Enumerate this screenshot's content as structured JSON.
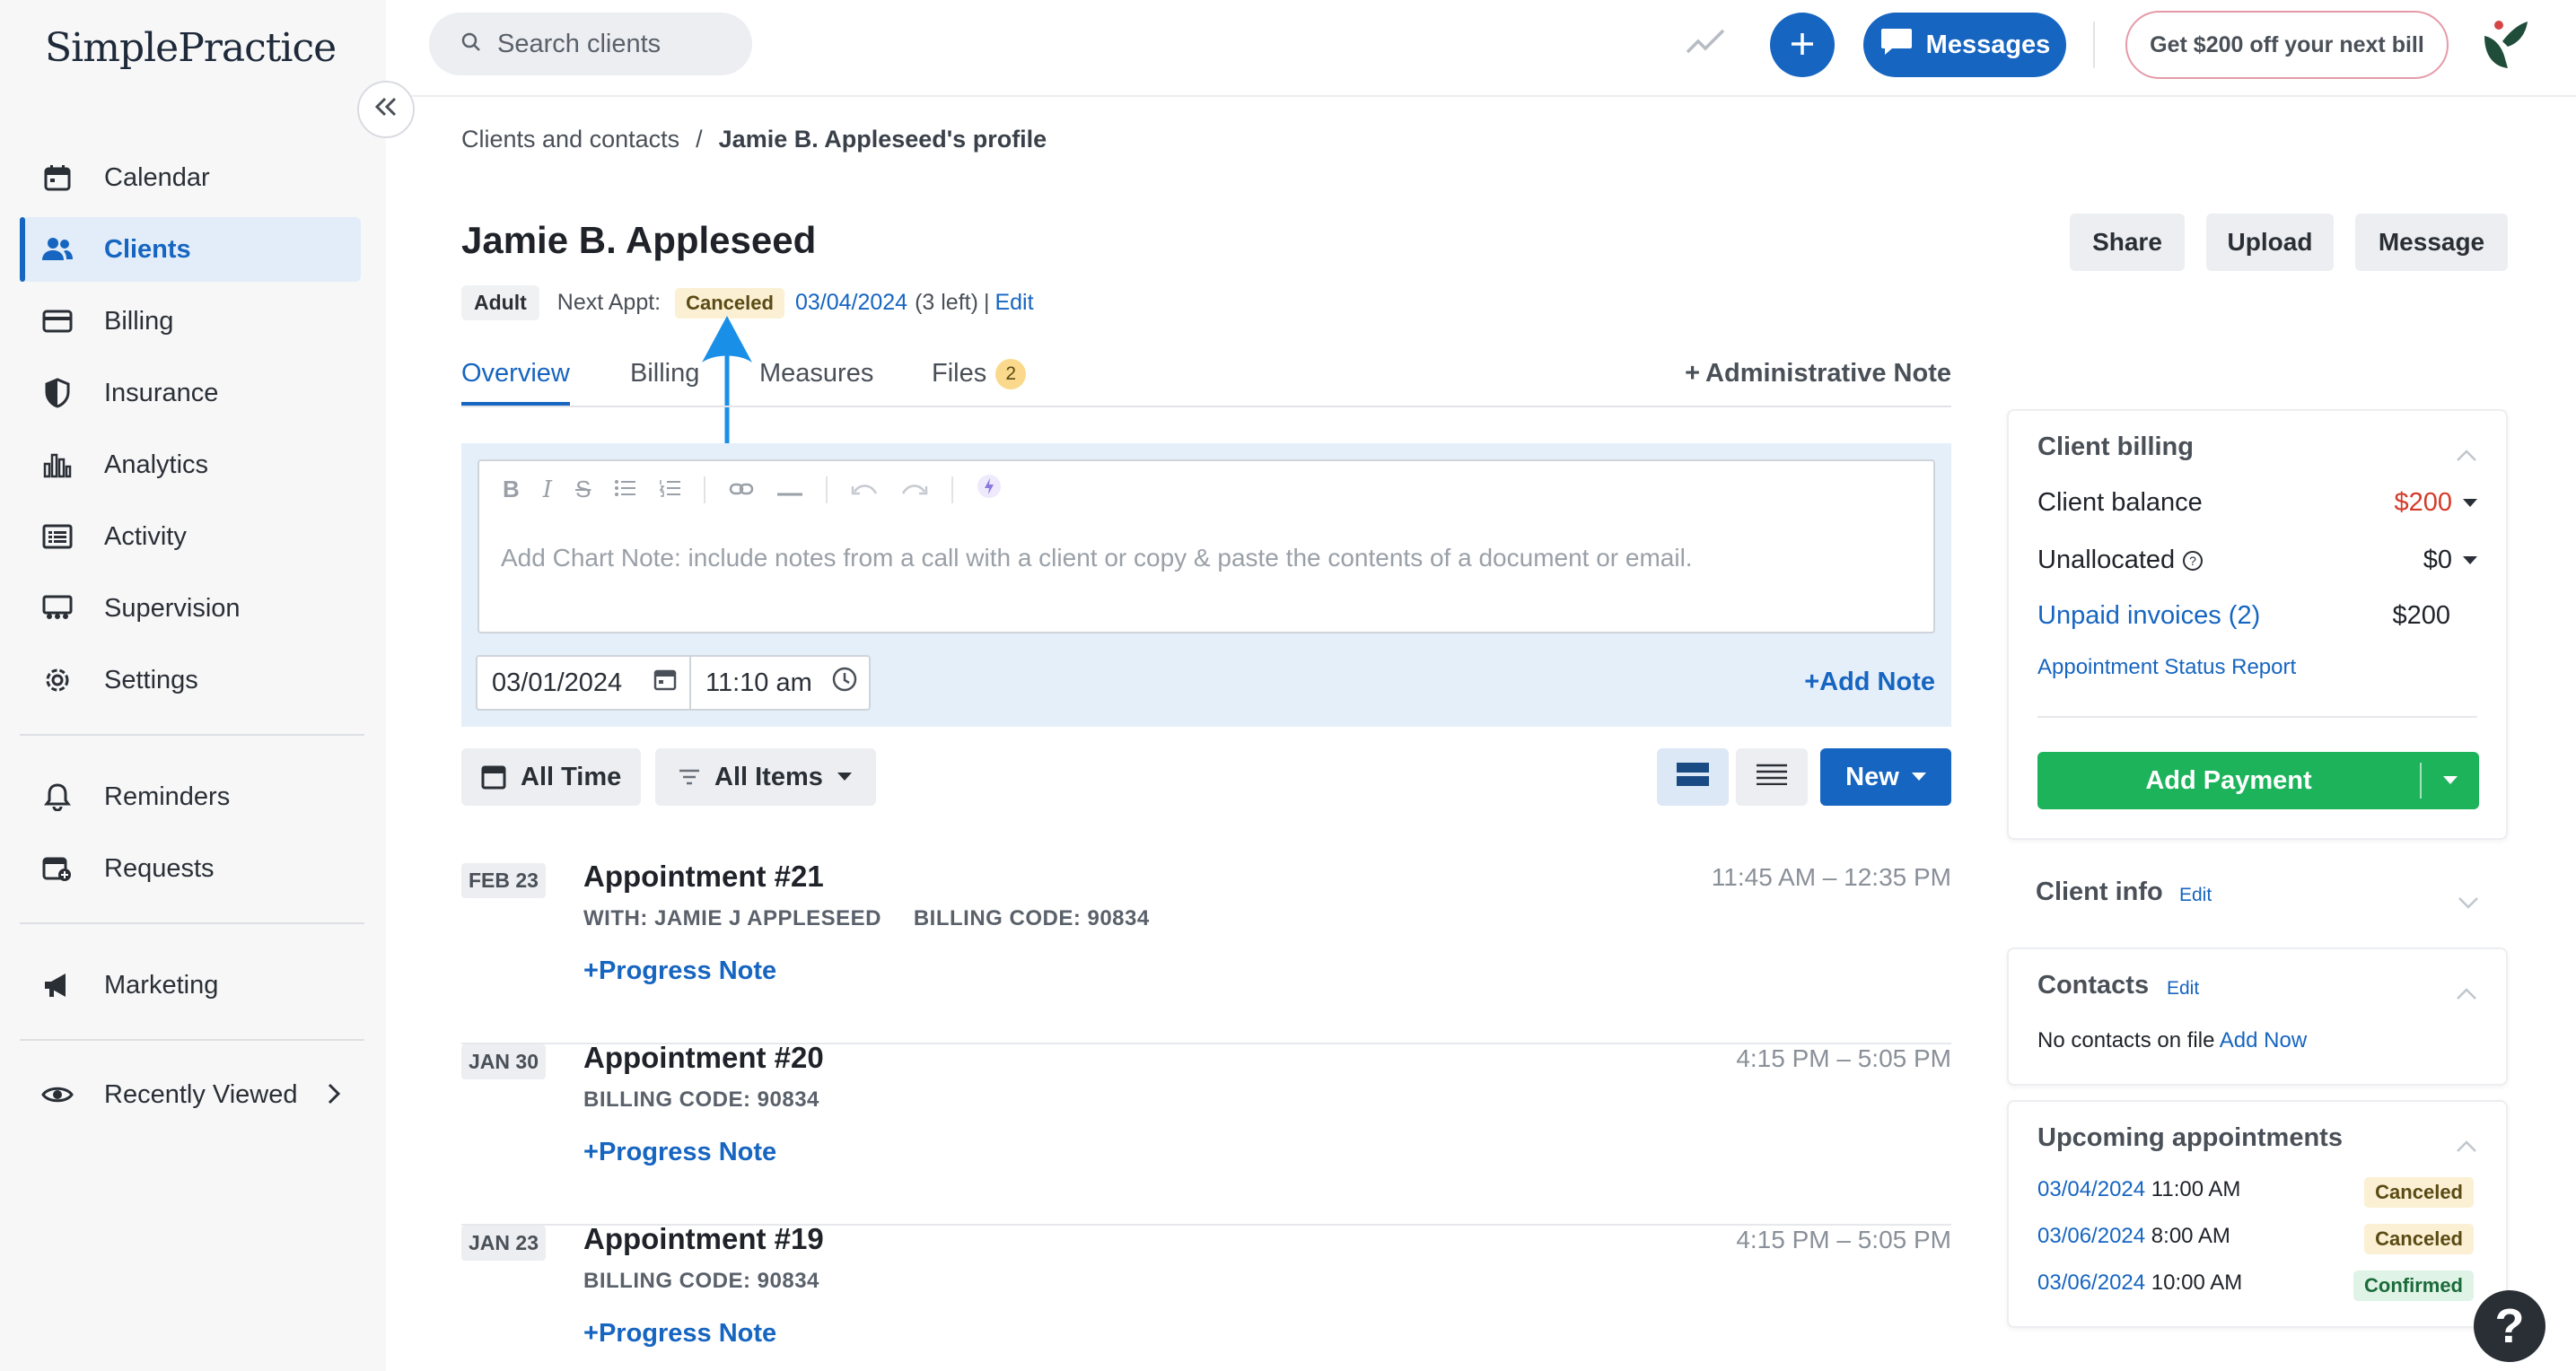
{
  "app": {
    "logo": "SimplePractice"
  },
  "sidebar": {
    "items": [
      {
        "label": "Calendar",
        "icon": "calendar-icon"
      },
      {
        "label": "Clients",
        "icon": "users-icon",
        "active": true
      },
      {
        "label": "Billing",
        "icon": "credit-card-icon"
      },
      {
        "label": "Insurance",
        "icon": "shield-icon"
      },
      {
        "label": "Analytics",
        "icon": "bar-chart-icon"
      },
      {
        "label": "Activity",
        "icon": "list-icon"
      },
      {
        "label": "Supervision",
        "icon": "supervision-icon"
      },
      {
        "label": "Settings",
        "icon": "gear-icon"
      },
      {
        "label": "Reminders",
        "icon": "bell-icon"
      },
      {
        "label": "Requests",
        "icon": "calendar-plus-icon"
      },
      {
        "label": "Marketing",
        "icon": "megaphone-icon"
      },
      {
        "label": "Recently Viewed",
        "icon": "eye-icon"
      }
    ]
  },
  "topbar": {
    "search_placeholder": "Search clients",
    "messages_label": "Messages",
    "promo_label": "Get $200 off your next bill"
  },
  "breadcrumb": {
    "parent": "Clients and contacts",
    "separator": "/",
    "current": "Jamie B. Appleseed's profile"
  },
  "client": {
    "name": "Jamie B. Appleseed",
    "type_badge": "Adult",
    "next_appt_label": "Next Appt:",
    "next_appt_status": "Canceled",
    "next_appt_date": "03/04/2024",
    "next_appt_left": "(3 left)",
    "pipe": "|",
    "edit_label": "Edit"
  },
  "header_buttons": {
    "share": "Share",
    "upload": "Upload",
    "message": "Message"
  },
  "tabs": {
    "overview": "Overview",
    "billing": "Billing",
    "measures": "Measures",
    "files": "Files",
    "files_count": "2",
    "admin_note": "Administrative Note"
  },
  "chart_note": {
    "placeholder": "Add Chart Note: include notes from a call with a client or copy & paste the contents of a document or email.",
    "date": "03/01/2024",
    "time": "11:10 am",
    "add_note": "Add Note"
  },
  "filters": {
    "time": "All Time",
    "items": "All Items",
    "new": "New"
  },
  "appointments": [
    {
      "date": "FEB 23",
      "title": "Appointment #21",
      "sub": "WITH: JAMIE J APPLESEED     BILLING CODE: 90834",
      "time": "11:45 AM – 12:35 PM",
      "action": "Progress Note"
    },
    {
      "date": "JAN 30",
      "title": "Appointment #20",
      "sub": "BILLING CODE: 90834",
      "time": "4:15 PM – 5:05 PM",
      "action": "Progress Note"
    },
    {
      "date": "JAN 23",
      "title": "Appointment #19",
      "sub": "BILLING CODE: 90834",
      "time": "4:15 PM – 5:05 PM",
      "action": "Progress Note"
    }
  ],
  "billing_card": {
    "title": "Client billing",
    "balance_label": "Client balance",
    "balance_value": "$200",
    "unallocated_label": "Unallocated",
    "unallocated_value": "$0",
    "unpaid_label": "Unpaid invoices (2)",
    "unpaid_value": "$200",
    "report_link": "Appointment Status Report",
    "add_payment": "Add Payment"
  },
  "client_info_card": {
    "title": "Client info",
    "edit": "Edit"
  },
  "contacts_card": {
    "title": "Contacts",
    "edit": "Edit",
    "empty_text": "No contacts on file",
    "add_now": "Add Now"
  },
  "upcoming_card": {
    "title": "Upcoming appointments",
    "items": [
      {
        "date": "03/04/2024",
        "time": "11:00 AM",
        "status": "Canceled"
      },
      {
        "date": "03/06/2024",
        "time": "8:00 AM",
        "status": "Canceled"
      },
      {
        "date": "03/06/2024",
        "time": "10:00 AM",
        "status": "Confirmed"
      }
    ]
  },
  "help_label": "?",
  "colors": {
    "brand": "#1665c1",
    "success": "#1db35b",
    "danger": "#d43b2a"
  }
}
